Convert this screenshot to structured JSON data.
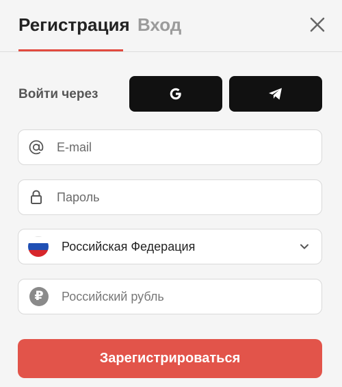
{
  "tabs": {
    "register_label": "Регистрация",
    "login_label": "Вход",
    "active": "register"
  },
  "close_icon": "close-icon",
  "social": {
    "label": "Войти через",
    "providers": [
      {
        "name": "google",
        "icon": "google-icon"
      },
      {
        "name": "telegram",
        "icon": "telegram-icon"
      }
    ]
  },
  "form": {
    "email_placeholder": "E-mail",
    "email_value": "",
    "password_placeholder": "Пароль",
    "password_value": "",
    "country_value": "Российская Федерация",
    "currency_placeholder": "Российский рубль",
    "currency_symbol": "₽"
  },
  "submit_label": "Зарегистрироваться",
  "colors": {
    "accent": "#e2544a",
    "social_button": "#111111",
    "background": "#f5f5f5"
  }
}
